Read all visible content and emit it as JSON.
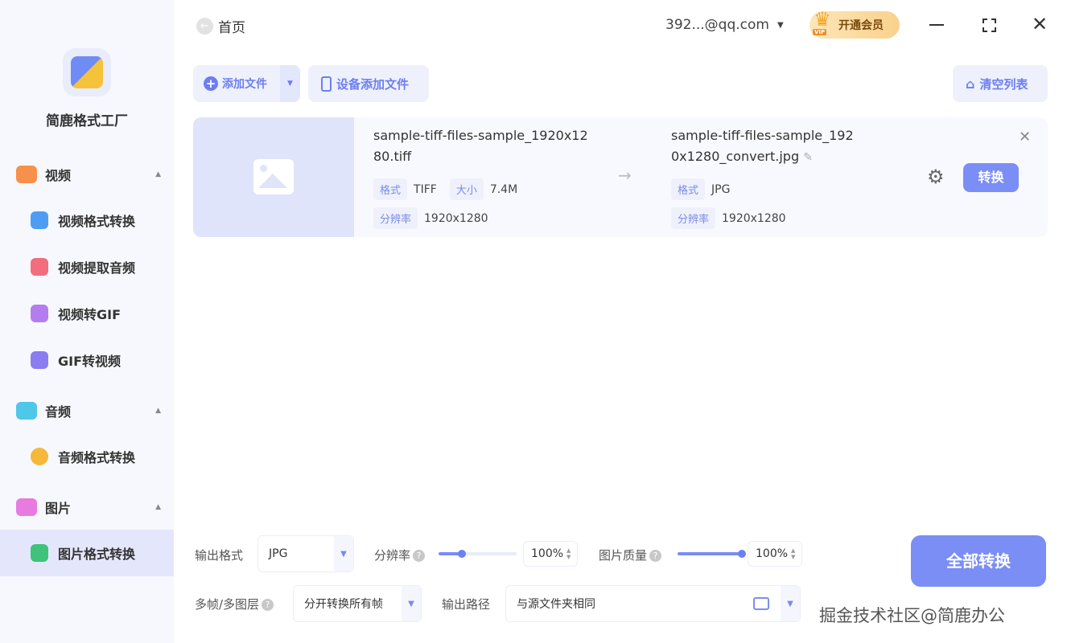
{
  "app": {
    "name": "简鹿格式工厂"
  },
  "sidebar": {
    "sections": [
      {
        "label": "视频",
        "items": [
          "视频格式转换",
          "视频提取音频",
          "视频转GIF",
          "GIF转视频"
        ]
      },
      {
        "label": "音频",
        "items": [
          "音频格式转换"
        ]
      },
      {
        "label": "图片",
        "items": [
          "图片格式转换"
        ]
      }
    ],
    "active": "图片格式转换"
  },
  "header": {
    "back_label": "首页",
    "account": "392...@qq.com",
    "vip_label": "开通会员",
    "vip_badge": "VIP"
  },
  "toolbar": {
    "add_file": "添加文件",
    "device_add": "设备添加文件",
    "clear_list": "清空列表"
  },
  "file": {
    "source_name": "sample-tiff-files-sample_1920x1280.tiff",
    "target_name": "sample-tiff-files-sample_1920x1280_convert.jpg",
    "format_label": "格式",
    "size_label": "大小",
    "res_label": "分辨率",
    "source_format": "TIFF",
    "source_size": "7.4M",
    "source_res": "1920x1280",
    "target_format": "JPG",
    "target_res": "1920x1280",
    "convert_label": "转换"
  },
  "settings": {
    "output_format_label": "输出格式",
    "output_format": "JPG",
    "resolution_label": "分辨率",
    "resolution": "100%",
    "resolution_fraction": 0.3,
    "quality_label": "图片质量",
    "quality": "100%",
    "quality_fraction": 1.0,
    "multiframe_label": "多帧/多图层",
    "multiframe": "分开转换所有帧",
    "output_path_label": "输出路径",
    "output_path": "与源文件夹相同",
    "convert_all": "全部转换"
  },
  "watermark": "掘金技术社区@简鹿办公",
  "colors": {
    "accent": "#7b8ef5",
    "sidebar_bg": "#f7f8fd"
  }
}
